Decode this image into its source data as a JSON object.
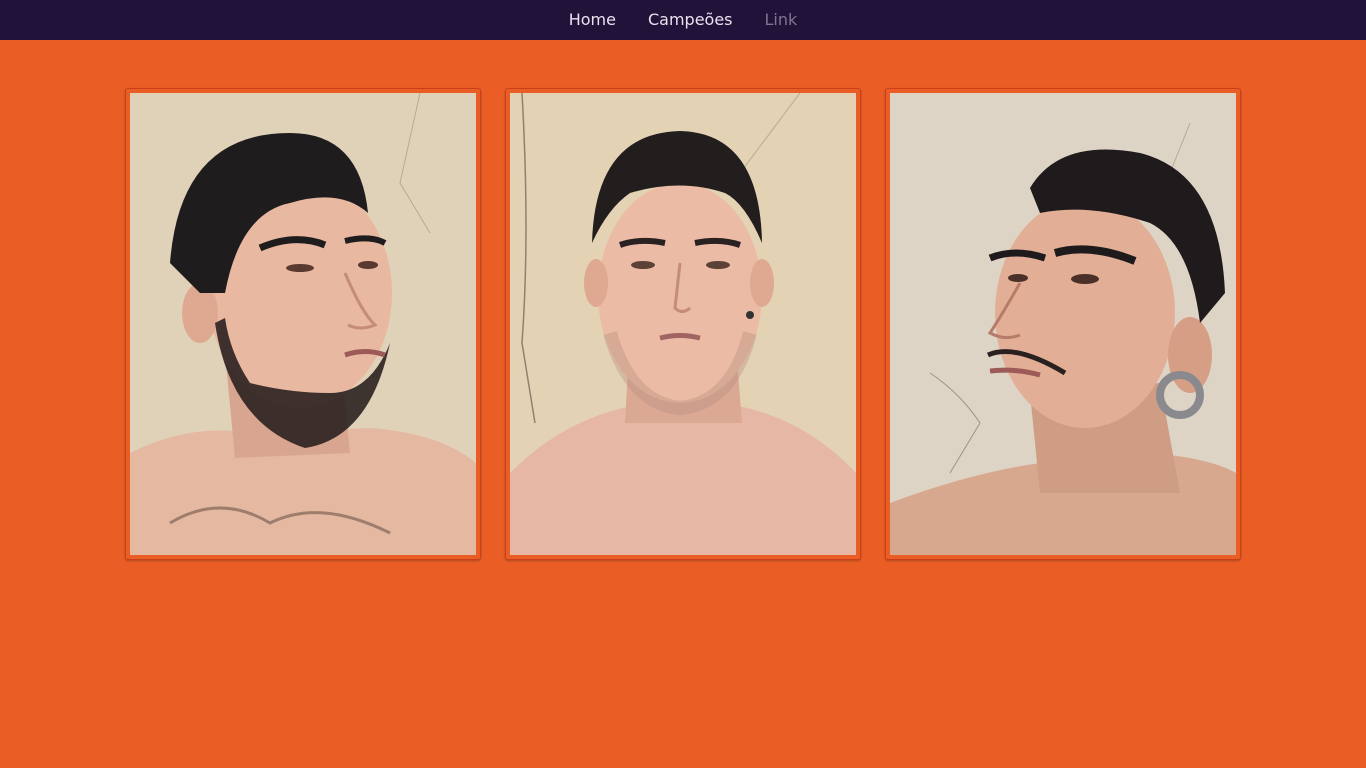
{
  "navbar": {
    "links": [
      {
        "label": "Home"
      },
      {
        "label": "Campeões"
      },
      {
        "label": "Link"
      }
    ]
  },
  "gallery": {
    "photos": [
      {
        "subject": "portrait-left-profile"
      },
      {
        "subject": "portrait-front"
      },
      {
        "subject": "portrait-right-profile"
      }
    ]
  },
  "colors": {
    "background": "#EA5E26",
    "navbar": "#21123A",
    "nav_text": "#E8E3EE",
    "nav_text_muted": "#7E7590",
    "card_border": "#C8401A"
  }
}
